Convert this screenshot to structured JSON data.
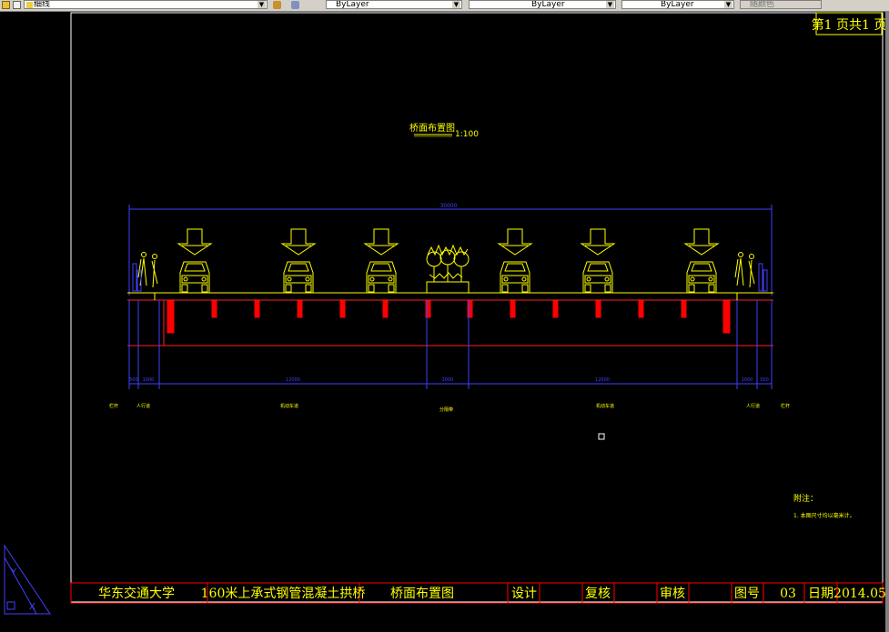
{
  "toolbar": {
    "layer_value": "细线",
    "color_value": "ByLayer",
    "linetype_value": "ByLayer",
    "lineweight_value": "ByLayer",
    "plotstyle_value": "随颜色",
    "layer_icon": "folder-icon",
    "layer_props_icon": "layer-properties-icon"
  },
  "drawing": {
    "page_label": "第1 页共1 页",
    "title": "桥面布置图",
    "scale": "1:100",
    "overall_dim": "30000",
    "dims": [
      "500",
      "1000",
      "12000",
      "3000",
      "12000",
      "1000",
      "500"
    ],
    "lane_labels": {
      "railing_left": "栏杆",
      "sidewalk_left": "人行道",
      "lanes_left": "机动车道",
      "median": "分隔带",
      "lanes_right": "机动车道",
      "sidewalk_right": "人行道",
      "railing_right": "栏杆"
    },
    "notes_title": "附注：",
    "notes_line": "1. 本图尺寸均以毫米计。"
  },
  "titleblock": {
    "school": "华东交通大学",
    "project": "160米上承式钢管混凝土拱桥",
    "drawing_name": "桥面布置图",
    "design": "设计",
    "check": "复核",
    "review": "审核",
    "drawing_no_label": "图号",
    "drawing_no": "03",
    "date_label": "日期",
    "date": "2014.05"
  },
  "colors": {
    "frame": "#ffffff",
    "accent_yellow": "#ffff00",
    "dimension_blue": "#0000ff",
    "structure_red": "#ff0000",
    "titleblock_red": "#ff0000"
  }
}
